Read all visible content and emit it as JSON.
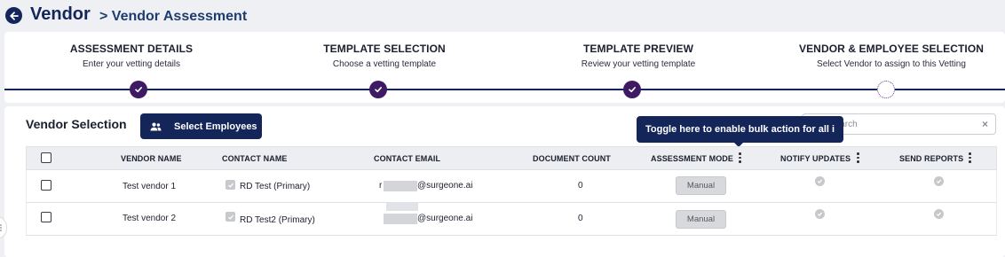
{
  "header": {
    "title": "Vendor",
    "breadcrumb": "> Vendor Assessment"
  },
  "steps": [
    {
      "title": "ASSESSMENT DETAILS",
      "subtitle": "Enter your vetting details",
      "status": "complete"
    },
    {
      "title": "TEMPLATE SELECTION",
      "subtitle": "Choose a vetting template",
      "status": "complete"
    },
    {
      "title": "TEMPLATE PREVIEW",
      "subtitle": "Review your vetting template",
      "status": "complete"
    },
    {
      "title": "VENDOR & EMPLOYEE SELECTION",
      "subtitle": "Select Vendor to assign to this Vetting",
      "status": "current"
    }
  ],
  "main": {
    "section_title": "Vendor Selection",
    "select_employees_label": "Select Employees",
    "search_placeholder": "Search",
    "search_clear": "×",
    "tooltip": "Toggle here to enable bulk action for all i"
  },
  "table": {
    "headers": {
      "vendor_name": "VENDOR NAME",
      "contact_name": "CONTACT NAME",
      "contact_email": "CONTACT EMAIL",
      "document_count": "DOCUMENT COUNT",
      "assessment_mode": "ASSESSMENT MODE",
      "notify_updates": "NOTIFY UPDATES",
      "send_reports": "SEND REPORTS"
    },
    "rows": [
      {
        "vendor_name": "Test vendor 1",
        "contact_name": "RD Test (Primary)",
        "email_prefix": "r",
        "email_domain": "@surgeone.ai",
        "document_count": "0",
        "assessment_mode": "Manual"
      },
      {
        "vendor_name": "Test vendor 2",
        "contact_name": "RD Test2 (Primary)",
        "email_prefix": "",
        "email_domain": "@surgeone.ai",
        "document_count": "0",
        "assessment_mode": "Manual"
      }
    ]
  },
  "colors": {
    "primary": "#14255a",
    "step_dot": "#3d1a63",
    "disabled": "#c7c8cc"
  }
}
